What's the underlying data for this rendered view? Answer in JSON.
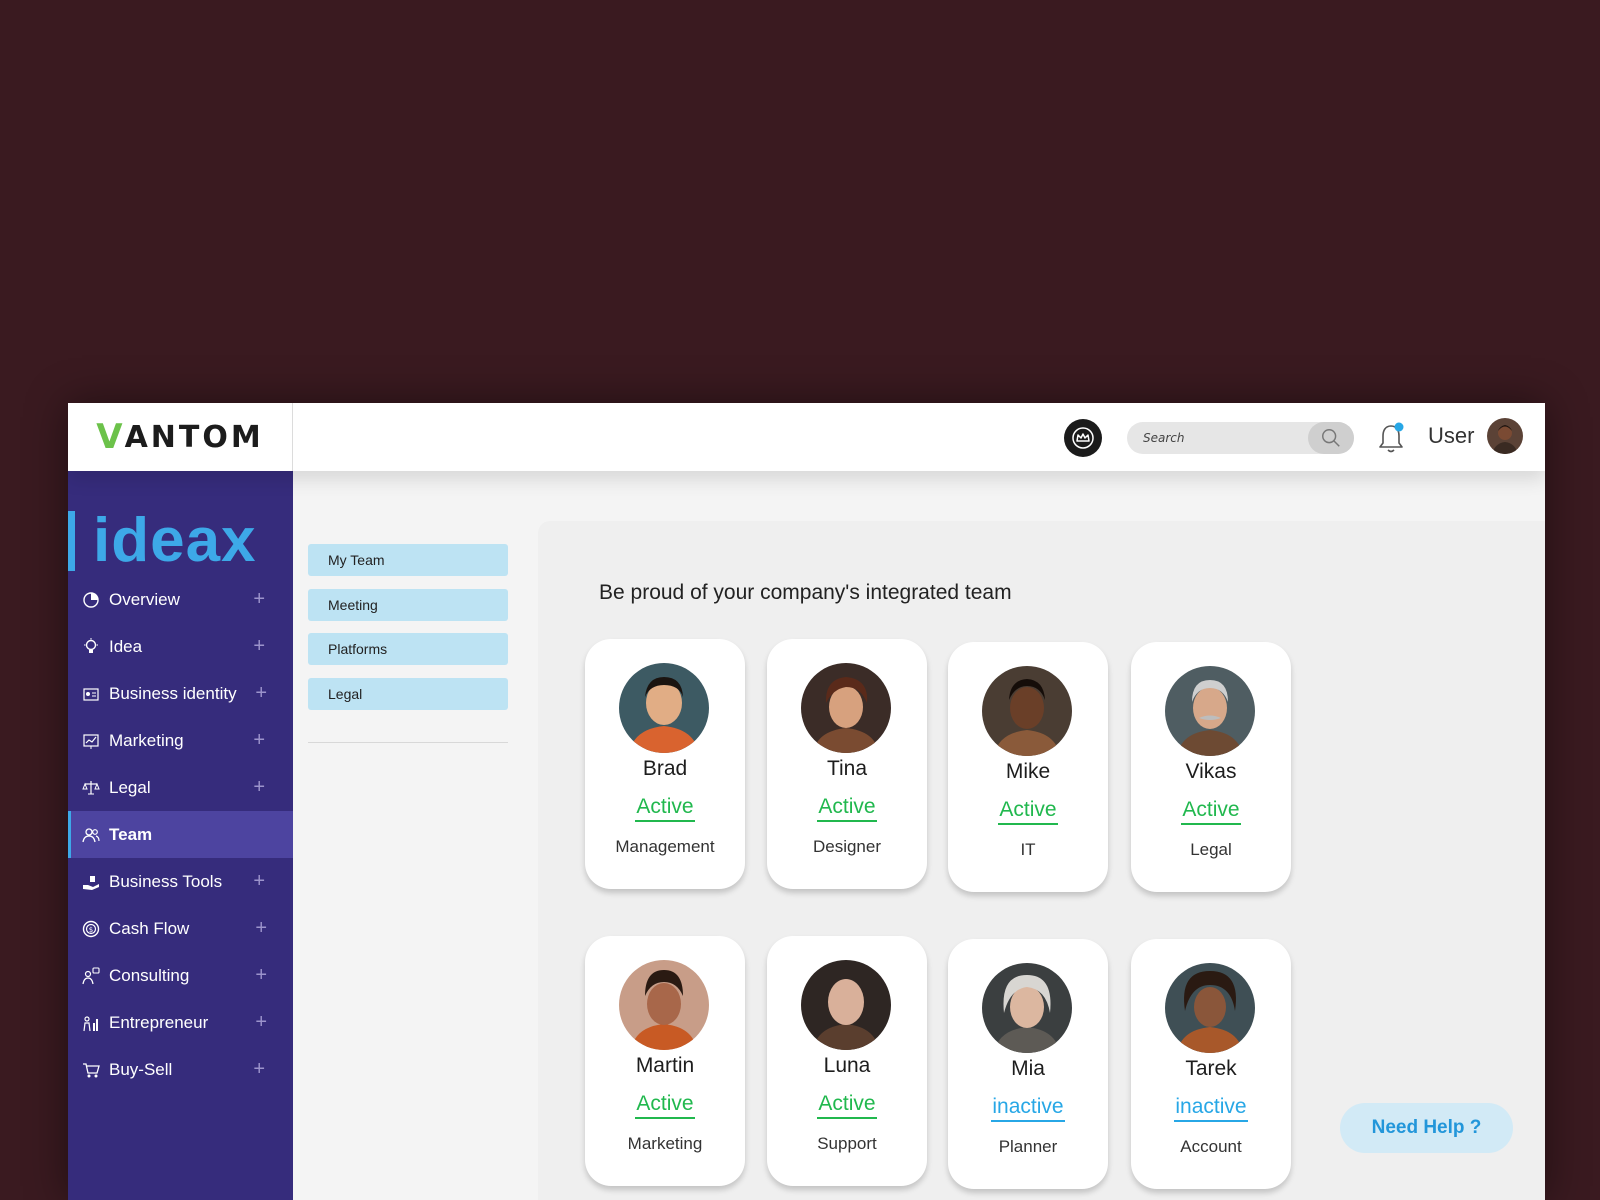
{
  "app": {
    "logo_v": "V",
    "logo_rest": "ANTOM",
    "brand": "ideax"
  },
  "topbar": {
    "search_placeholder": "Search",
    "user_label": "User",
    "icons": [
      "crown-badge-icon",
      "search-icon",
      "bell-icon"
    ]
  },
  "sidebar": {
    "items": [
      {
        "label": "Overview",
        "icon": "chart-pie-icon"
      },
      {
        "label": "Idea",
        "icon": "lightbulb-icon"
      },
      {
        "label": "Business identity",
        "icon": "id-card-icon"
      },
      {
        "label": "Marketing",
        "icon": "marketing-board-icon"
      },
      {
        "label": "Legal",
        "icon": "scales-icon"
      },
      {
        "label": "Team",
        "icon": "team-icon"
      },
      {
        "label": "Business Tools",
        "icon": "hand-tools-icon"
      },
      {
        "label": "Cash Flow",
        "icon": "coin-icon"
      },
      {
        "label": "Consulting",
        "icon": "consultant-icon"
      },
      {
        "label": "Entrepreneur",
        "icon": "entrepreneur-icon"
      },
      {
        "label": "Buy-Sell",
        "icon": "cart-icon"
      }
    ]
  },
  "subnav": {
    "items": [
      {
        "label": "My Team"
      },
      {
        "label": "Meeting"
      },
      {
        "label": "Platforms"
      },
      {
        "label": "Legal"
      }
    ]
  },
  "main": {
    "headline": "Be proud of your company's integrated team",
    "members": [
      {
        "name": "Brad",
        "status": "Active",
        "role": "Management"
      },
      {
        "name": "Tina",
        "status": "Active",
        "role": "Designer"
      },
      {
        "name": "Mike",
        "status": "Active",
        "role": "IT"
      },
      {
        "name": "Vikas",
        "status": "Active",
        "role": "Legal"
      },
      {
        "name": "Martin",
        "status": "Active",
        "role": "Marketing"
      },
      {
        "name": "Luna",
        "status": "Active",
        "role": "Support"
      },
      {
        "name": "Mia",
        "status": "inactive",
        "role": "Planner"
      },
      {
        "name": "Tarek",
        "status": "inactive",
        "role": "Account"
      }
    ]
  },
  "help": {
    "label": "Need Help ?"
  },
  "colors": {
    "background": "#3a1a20",
    "sidebar": "#362c7c",
    "sidebar_active": "#4d44a0",
    "accent_blue": "#3da9e8",
    "logo_green": "#6cc24a",
    "active_green": "#21b84e",
    "inactive_blue": "#27a7e6",
    "subnav_button": "#bde3f3"
  }
}
